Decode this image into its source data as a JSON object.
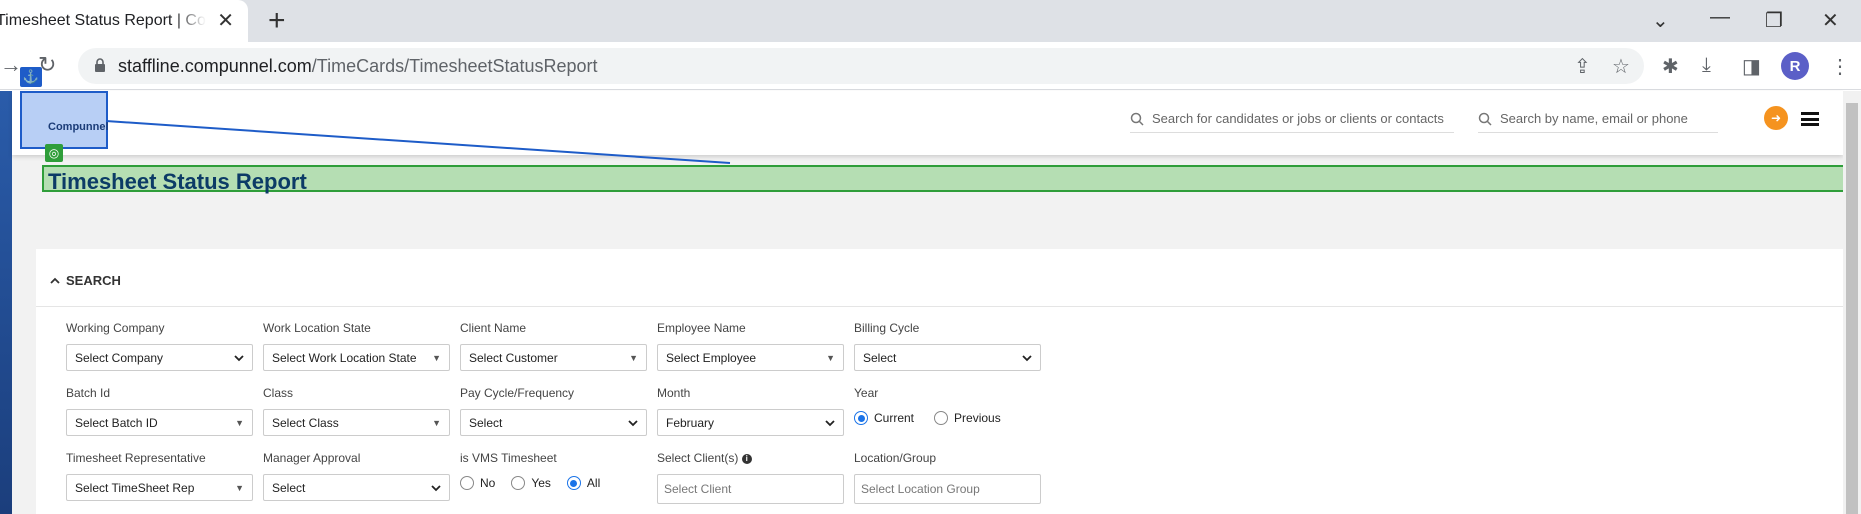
{
  "browser": {
    "tab_title": "Timesheet Status Report | Compunnel",
    "url_domain": "staffline.compunnel.com",
    "url_path": "/TimeCards/TimesheetStatusReport",
    "avatar_letter": "R"
  },
  "header": {
    "logo_text": "Compunnel",
    "search_candidates_placeholder": "Search for candidates or jobs or clients or contacts",
    "search_people_placeholder": "Search by name, email or phone",
    "accent_color": "#f5931f"
  },
  "page": {
    "title": "Timesheet Status Report"
  },
  "search": {
    "section_label": "SEARCH",
    "fields": {
      "working_company": {
        "label": "Working Company",
        "value": "Select Company"
      },
      "work_location_state": {
        "label": "Work Location State",
        "value": "Select Work Location State"
      },
      "client_name": {
        "label": "Client Name",
        "value": "Select Customer"
      },
      "employee_name": {
        "label": "Employee Name",
        "value": "Select Employee"
      },
      "billing_cycle": {
        "label": "Billing Cycle",
        "value": "Select"
      },
      "batch_id": {
        "label": "Batch Id",
        "value": "Select Batch ID"
      },
      "class": {
        "label": "Class",
        "value": "Select Class"
      },
      "pay_cycle": {
        "label": "Pay Cycle/Frequency",
        "value": "Select"
      },
      "month": {
        "label": "Month",
        "value": "February"
      },
      "year": {
        "label": "Year",
        "options": [
          "Current",
          "Previous"
        ],
        "selected": "Current"
      },
      "timesheet_rep": {
        "label": "Timesheet Representative",
        "value": "Select TimeSheet Rep"
      },
      "manager_approval": {
        "label": "Manager Approval",
        "value": "Select"
      },
      "vms_timesheet": {
        "label": "is VMS Timesheet",
        "options": [
          "No",
          "Yes",
          "All"
        ],
        "selected": "All"
      },
      "select_clients": {
        "label": "Select Client(s)",
        "placeholder": "Select Client"
      },
      "location_group": {
        "label": "Location/Group",
        "placeholder": "Select Location Group"
      }
    }
  }
}
